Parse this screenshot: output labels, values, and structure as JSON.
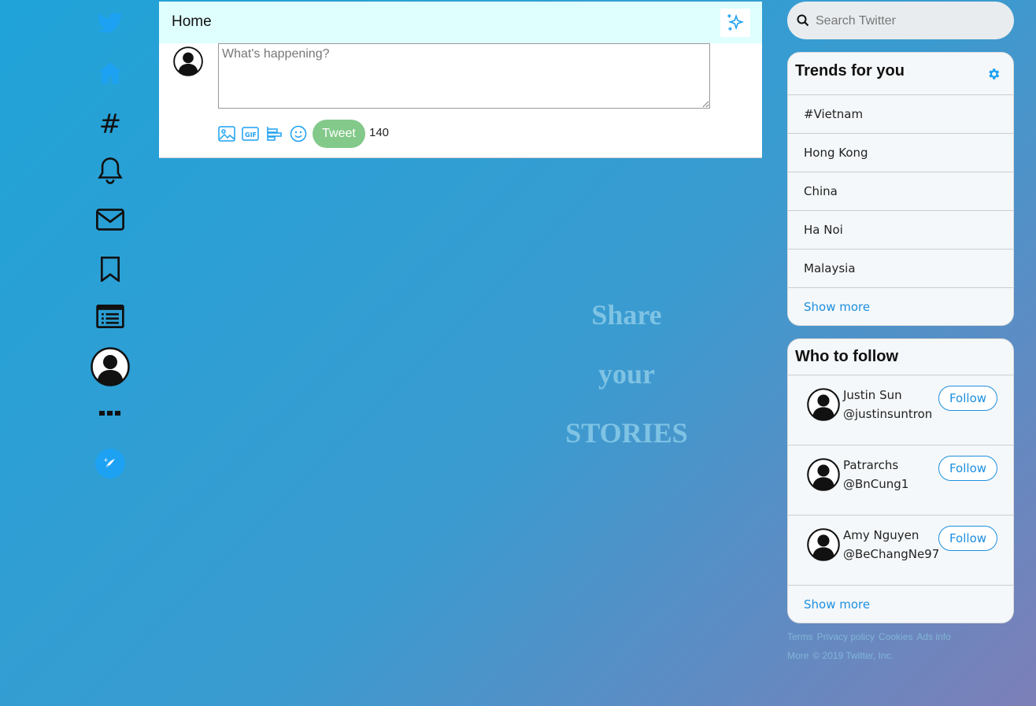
{
  "header": {
    "title": "Home"
  },
  "composer": {
    "placeholder": "What's happening?",
    "tweet_label": "Tweet",
    "char_count": "140"
  },
  "stories": {
    "line1": "Share",
    "line2": "your",
    "line3": "STORIES"
  },
  "search": {
    "placeholder": "Search Twitter"
  },
  "trends": {
    "title": "Trends for you",
    "items": [
      "#Vietnam",
      "Hong Kong",
      "China",
      "Ha Noi",
      "Malaysia"
    ],
    "show_more": "Show more"
  },
  "who_to_follow": {
    "title": "Who to follow",
    "users": [
      {
        "name": "Justin Sun",
        "handle": "@justinsuntron",
        "follow_label": "Follow"
      },
      {
        "name": "Patrarchs",
        "handle": "@BnCung1",
        "follow_label": "Follow"
      },
      {
        "name": "Amy Nguyen",
        "handle": "@BeChangNe97",
        "follow_label": "Follow"
      }
    ],
    "show_more": "Show more"
  },
  "footer": {
    "links": [
      "Terms",
      "Privacy policy",
      "Cookies",
      "Ads info",
      "More"
    ],
    "copyright": "© 2019 Twitter, Inc."
  },
  "colors": {
    "accent": "#1da1f2",
    "tweet_button": "#83c98a",
    "header_bg": "#dffefe"
  },
  "icons": [
    "twitter-logo-icon",
    "home-icon",
    "hashtag-icon",
    "bell-icon",
    "mail-icon",
    "bookmark-icon",
    "list-icon",
    "profile-avatar-icon",
    "more-icon",
    "compose-icon"
  ]
}
